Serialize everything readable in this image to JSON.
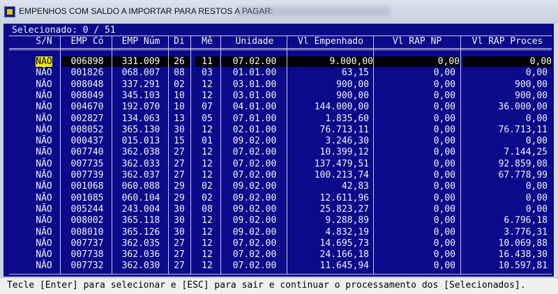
{
  "window": {
    "title": "EMPENHOS COM SALDO A IMPORTAR PARA RESTOS A PAGAR:"
  },
  "selection": {
    "text": "Selecionado: 0 / 51"
  },
  "columns": [
    "S/N",
    "EMP Có",
    "EMP Núm",
    "Di",
    "Mê",
    "Unidade",
    "Vl Empenhado",
    "Vl RAP NP",
    "Vl RAP Proces"
  ],
  "rows": [
    {
      "sn": "NÃO",
      "cod": "006898",
      "num": "331.009",
      "di": "26",
      "me": "11",
      "uni": "07.02.00",
      "emp": "9.000,00",
      "np": "0,00",
      "proc": "0,00",
      "highlight": true
    },
    {
      "sn": "NÃO",
      "cod": "001826",
      "num": "068.007",
      "di": "08",
      "me": "03",
      "uni": "01.01.00",
      "emp": "63,15",
      "np": "0,00",
      "proc": "0,00"
    },
    {
      "sn": "NÃO",
      "cod": "008048",
      "num": "337.291",
      "di": "02",
      "me": "12",
      "uni": "03.01.00",
      "emp": "900,00",
      "np": "0,00",
      "proc": "900,00"
    },
    {
      "sn": "NÃO",
      "cod": "008049",
      "num": "345.103",
      "di": "10",
      "me": "12",
      "uni": "03.01.00",
      "emp": "900,00",
      "np": "0,00",
      "proc": "900,00"
    },
    {
      "sn": "NÃO",
      "cod": "004670",
      "num": "192.070",
      "di": "10",
      "me": "07",
      "uni": "04.01.00",
      "emp": "144.000,00",
      "np": "0,00",
      "proc": "36.000,00"
    },
    {
      "sn": "NÃO",
      "cod": "002827",
      "num": "134.063",
      "di": "13",
      "me": "05",
      "uni": "07.01.00",
      "emp": "1.835,60",
      "np": "0,00",
      "proc": "0,00"
    },
    {
      "sn": "NÃO",
      "cod": "008052",
      "num": "365.130",
      "di": "30",
      "me": "12",
      "uni": "02.01.00",
      "emp": "76.713,11",
      "np": "0,00",
      "proc": "76.713,11"
    },
    {
      "sn": "NÃO",
      "cod": "000437",
      "num": "015.013",
      "di": "15",
      "me": "01",
      "uni": "09.02.00",
      "emp": "3.246,30",
      "np": "0,00",
      "proc": "0,00"
    },
    {
      "sn": "NÃO",
      "cod": "007740",
      "num": "362.038",
      "di": "27",
      "me": "12",
      "uni": "07.02.00",
      "emp": "10.399,12",
      "np": "0,00",
      "proc": "7.144,25"
    },
    {
      "sn": "NÃO",
      "cod": "007735",
      "num": "362.033",
      "di": "27",
      "me": "12",
      "uni": "07.02.00",
      "emp": "137.479,51",
      "np": "0,00",
      "proc": "92.859,08"
    },
    {
      "sn": "NÃO",
      "cod": "007739",
      "num": "362.037",
      "di": "27",
      "me": "12",
      "uni": "07.02.00",
      "emp": "100.213,74",
      "np": "0,00",
      "proc": "67.778,99"
    },
    {
      "sn": "NÃO",
      "cod": "001068",
      "num": "060.088",
      "di": "29",
      "me": "02",
      "uni": "09.02.00",
      "emp": "42,83",
      "np": "0,00",
      "proc": "0,00"
    },
    {
      "sn": "NÃO",
      "cod": "001085",
      "num": "060.104",
      "di": "29",
      "me": "02",
      "uni": "09.02.00",
      "emp": "12.611,96",
      "np": "0,00",
      "proc": "0,00"
    },
    {
      "sn": "NÃO",
      "cod": "005244",
      "num": "243.004",
      "di": "30",
      "me": "08",
      "uni": "09.02.00",
      "emp": "25.823,27",
      "np": "0,00",
      "proc": "0,00"
    },
    {
      "sn": "NÃO",
      "cod": "008002",
      "num": "365.118",
      "di": "30",
      "me": "12",
      "uni": "09.02.00",
      "emp": "9.288,89",
      "np": "0,00",
      "proc": "6.796,18"
    },
    {
      "sn": "NÃO",
      "cod": "008010",
      "num": "365.126",
      "di": "30",
      "me": "12",
      "uni": "09.02.00",
      "emp": "4.832,19",
      "np": "0,00",
      "proc": "3.776,31"
    },
    {
      "sn": "NÃO",
      "cod": "007737",
      "num": "362.035",
      "di": "27",
      "me": "12",
      "uni": "07.02.00",
      "emp": "14.695,73",
      "np": "0,00",
      "proc": "10.069,88"
    },
    {
      "sn": "NÃO",
      "cod": "007738",
      "num": "362.036",
      "di": "27",
      "me": "12",
      "uni": "07.02.00",
      "emp": "24.166,18",
      "np": "0,00",
      "proc": "16.438,30"
    },
    {
      "sn": "NÃO",
      "cod": "007732",
      "num": "362.030",
      "di": "27",
      "me": "12",
      "uni": "07.02.00",
      "emp": "11.645,94",
      "np": "0,00",
      "proc": "10.597,81"
    }
  ],
  "status": {
    "text": "Tecle [Enter] para selecionar e [ESC] para sair e continuar o processamento dos [Selecionados]."
  },
  "colors": {
    "background": "#0a0a8a",
    "text": "#f2f2f2",
    "selected_sn": "#f2e600",
    "selected_cell": "#000000"
  }
}
